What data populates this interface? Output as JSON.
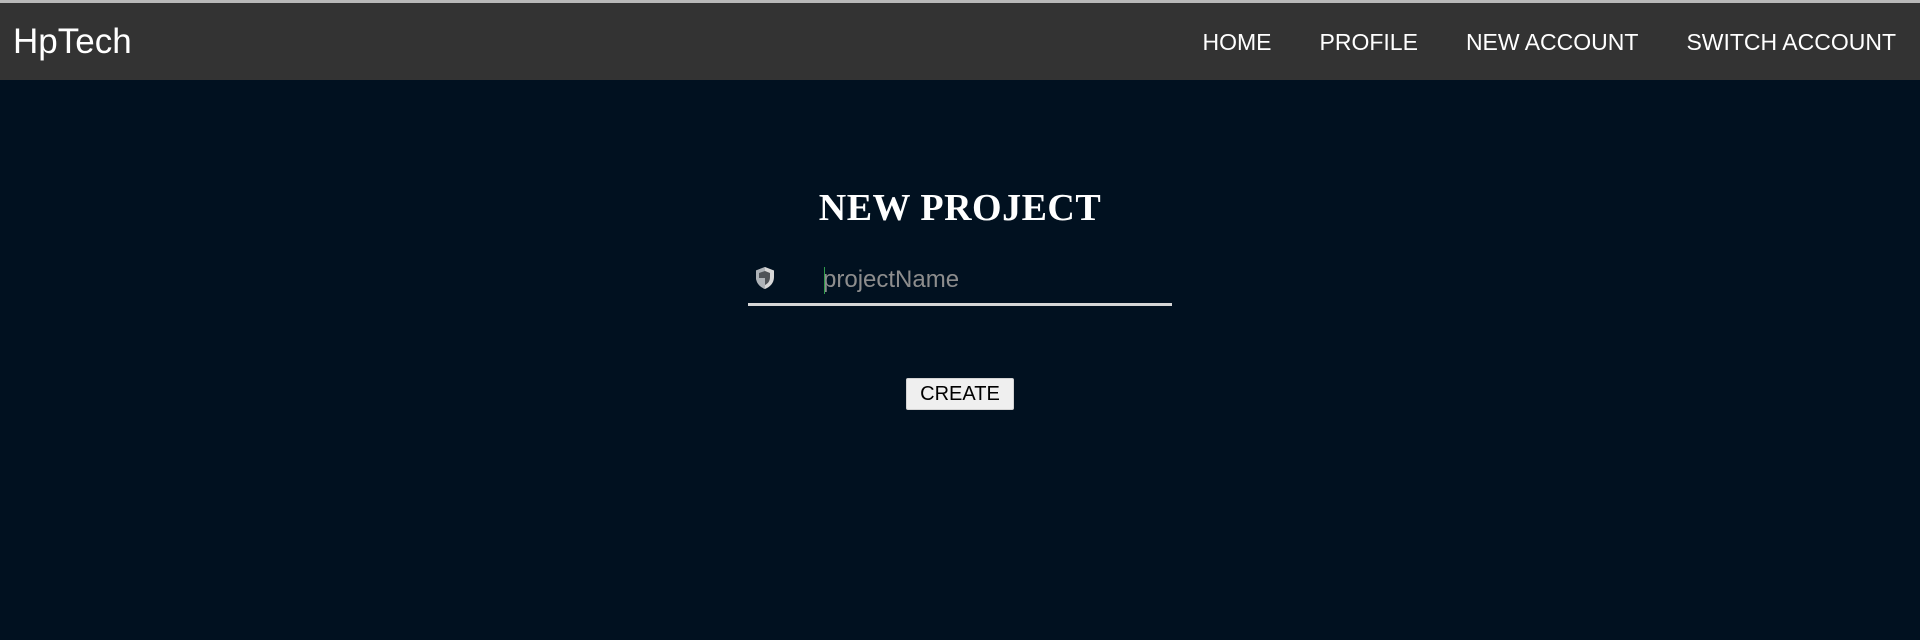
{
  "navbar": {
    "brand": "HpTech",
    "links": [
      {
        "label": "HOME"
      },
      {
        "label": "PROFILE"
      },
      {
        "label": "NEW ACCOUNT"
      },
      {
        "label": "SWITCH ACCOUNT"
      }
    ]
  },
  "main": {
    "title": "NEW PROJECT",
    "project_name_placeholder": "projectName",
    "project_name_value": "",
    "create_label": "CREATE"
  },
  "icons": {
    "input_icon": "shield-icon"
  },
  "colors": {
    "page_background": "#011120",
    "navbar_background": "#333333",
    "text": "#ffffff"
  }
}
